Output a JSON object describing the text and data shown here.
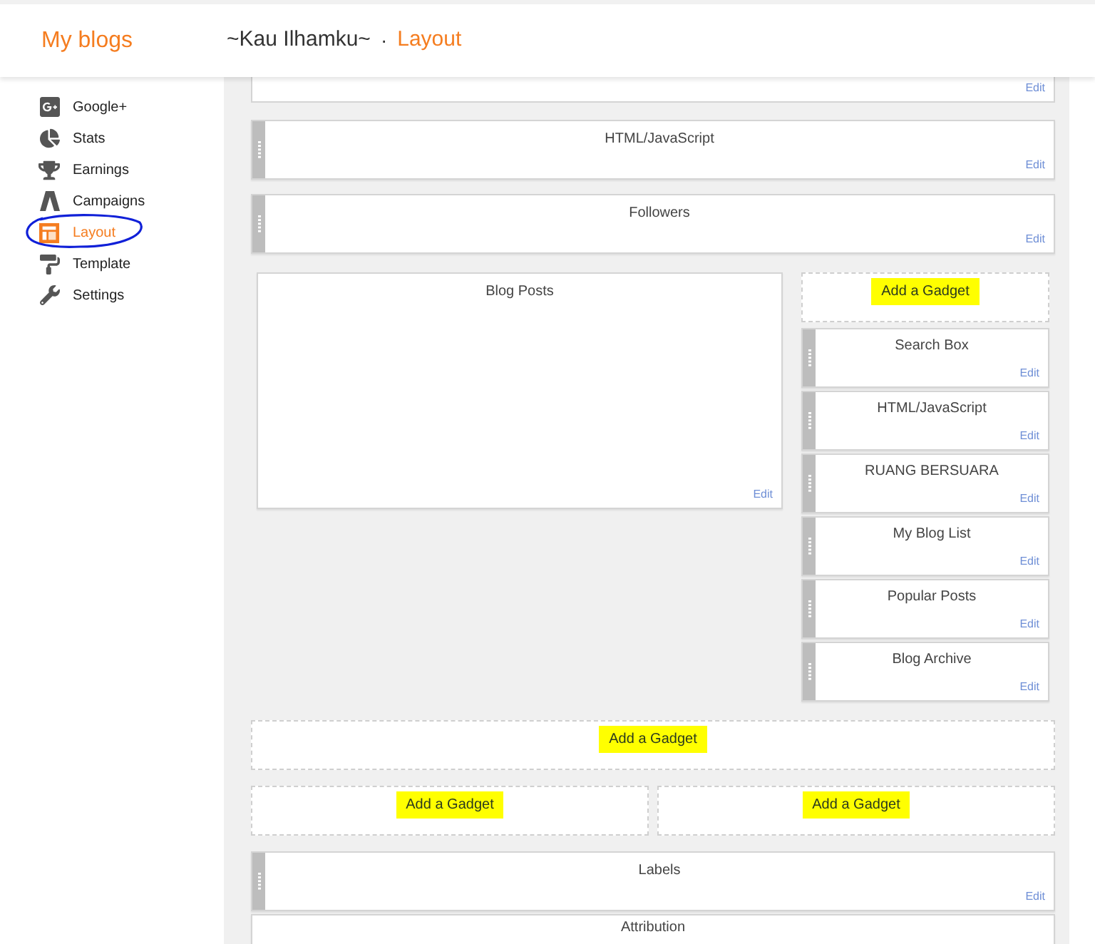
{
  "header": {
    "brand": "My blogs",
    "blog_title": "~Kau Ilhamku~",
    "separator": "·",
    "page": "Layout"
  },
  "sidebar": {
    "items": [
      {
        "label": "Google+",
        "selected": false,
        "annotated": false
      },
      {
        "label": "Stats",
        "selected": false,
        "annotated": false
      },
      {
        "label": "Earnings",
        "selected": false,
        "annotated": false
      },
      {
        "label": "Campaigns",
        "selected": false,
        "annotated": false
      },
      {
        "label": "Layout",
        "selected": true,
        "annotated": true
      },
      {
        "label": "Template",
        "selected": false,
        "annotated": false
      },
      {
        "label": "Settings",
        "selected": false,
        "annotated": false
      }
    ]
  },
  "layout": {
    "top_widget": {
      "edit": "Edit"
    },
    "header_widgets": [
      {
        "title": "HTML/JavaScript",
        "edit": "Edit"
      },
      {
        "title": "Followers",
        "edit": "Edit"
      }
    ],
    "main_column": {
      "title": "Blog Posts",
      "edit": "Edit"
    },
    "side_column": {
      "add_gadget": {
        "label": "Add a Gadget",
        "highlighted": true
      },
      "widgets": [
        {
          "title": "Search Box",
          "edit": "Edit"
        },
        {
          "title": "HTML/JavaScript",
          "edit": "Edit"
        },
        {
          "title": "RUANG BERSUARA",
          "edit": "Edit"
        },
        {
          "title": "My Blog List",
          "edit": "Edit"
        },
        {
          "title": "Popular Posts",
          "edit": "Edit"
        },
        {
          "title": "Blog Archive",
          "edit": "Edit"
        }
      ]
    },
    "footer_add_gadget": {
      "label": "Add a Gadget",
      "highlighted": true
    },
    "footer_columns": [
      {
        "label": "Add a Gadget",
        "highlighted": true
      },
      {
        "label": "Add a Gadget",
        "highlighted": true
      }
    ],
    "footer_widgets": [
      {
        "title": "Labels",
        "edit": "Edit"
      },
      {
        "title": "Attribution"
      }
    ]
  }
}
